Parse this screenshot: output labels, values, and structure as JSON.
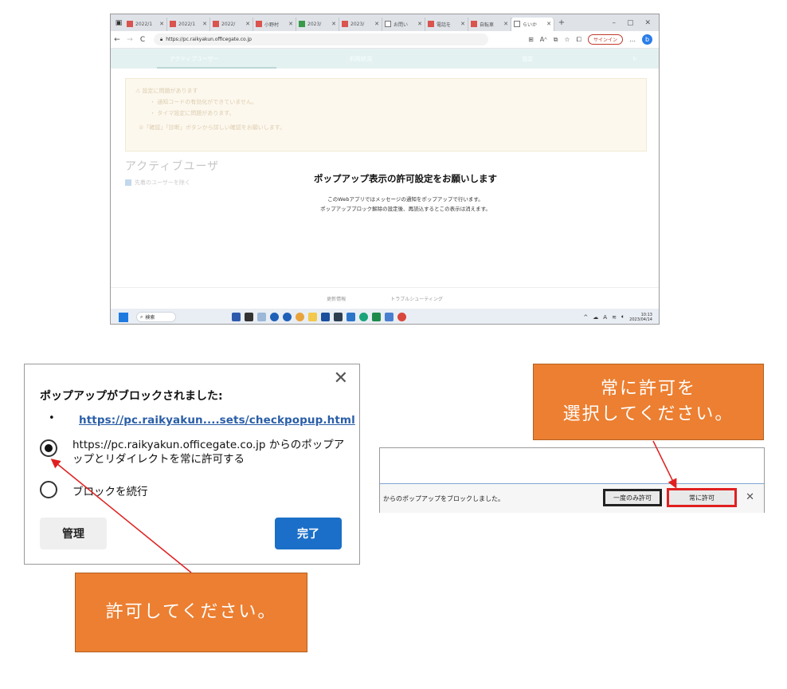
{
  "browser": {
    "tabs": [
      {
        "label": "2022/1",
        "fav": "red"
      },
      {
        "label": "2022/1",
        "fav": "red"
      },
      {
        "label": "2022/",
        "fav": "red"
      },
      {
        "label": "小野村",
        "fav": "red"
      },
      {
        "label": "2023/",
        "fav": "green"
      },
      {
        "label": "2023/",
        "fav": "red"
      },
      {
        "label": "お問い",
        "fav": "white"
      },
      {
        "label": "電話を",
        "fav": "red"
      },
      {
        "label": "自転車",
        "fav": "red"
      },
      {
        "label": "らいか",
        "fav": "white"
      }
    ],
    "url": "https://pc.raikyakun.officegate.co.jp",
    "signin_label": "サインイン",
    "app_nav": [
      "アクティブユーザー",
      "利用状況",
      "設定"
    ],
    "alert_title": "設定に問題があります",
    "alert_lines": [
      "・ 通知コードの有効化ができていません。",
      "・ タイマ設定に問題があります。",
      "①「確認」「診断」ボタンから詳しい確認をお願いします。"
    ],
    "section_title": "アクティブユーザ",
    "checkbox_label": "先着のユーザーを除く",
    "popup_title": "ポップアップ表示の許可設定をお願いします",
    "popup_line1": "このWebアプリではメッセージの通知をポップアップで行います。",
    "popup_line2": "ポップアップブロック解除の設定後、再読込するとこの表示は消えます。",
    "footer_links": [
      "更新情報",
      "トラブルシューティング"
    ],
    "taskbar_search": "検索",
    "clock_time": "10:13",
    "clock_date": "2023/04/14"
  },
  "dialog": {
    "title": "ポップアップがブロックされました:",
    "bullet": "•",
    "link": "https://pc.raikyakun....sets/checkpopup.html",
    "option_allow": "https://pc.raikyakun.officegate.co.jp からのポップアップとリダイレクトを常に許可する",
    "option_block": "ブロックを続行",
    "manage_label": "管理",
    "done_label": "完了",
    "close_icon": "close-icon"
  },
  "callouts": {
    "left": "許可してください。",
    "right_line1": "常に許可を",
    "right_line2": "選択してください。",
    "color": "#ec7f31"
  },
  "notification": {
    "message": "からのポップアップをブロックしました。",
    "once_label": "一度のみ許可",
    "always_label": "常に許可",
    "highlight_color": "#e02020"
  }
}
